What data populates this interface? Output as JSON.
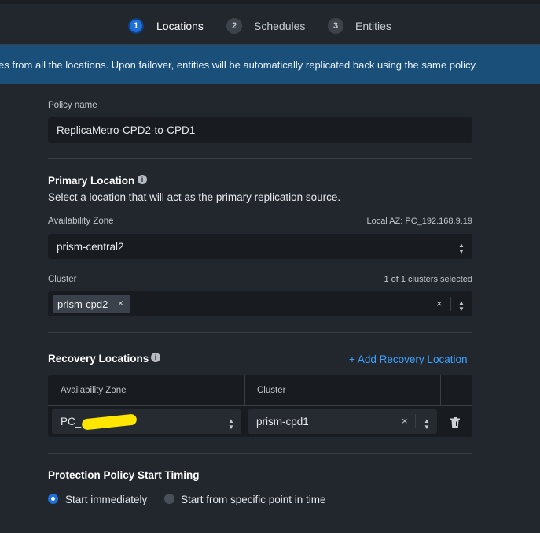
{
  "wizard": {
    "steps": [
      {
        "num": "1",
        "label": "Locations"
      },
      {
        "num": "2",
        "label": "Schedules"
      },
      {
        "num": "3",
        "label": "Entities"
      }
    ],
    "active_step": 0
  },
  "banner": {
    "text": "es from all the locations. Upon failover, entities will be automatically replicated back using the same policy."
  },
  "policy": {
    "name_label": "Policy name",
    "name_value": "ReplicaMetro-CPD2-to-CPD1"
  },
  "primary": {
    "heading": "Primary Location",
    "description": "Select a location that will act as the primary replication source.",
    "az_label": "Availability Zone",
    "local_az": "Local AZ: PC_192.168.9.19",
    "az_value": "prism-central2",
    "cluster_label": "Cluster",
    "cluster_count": "1 of 1 clusters selected",
    "cluster_tag": "prism-cpd2"
  },
  "recovery": {
    "heading": "Recovery Locations",
    "add_link": "+ Add Recovery Location",
    "col_az": "Availability Zone",
    "col_cluster": "Cluster",
    "row": {
      "az_value": "PC_",
      "cluster_value": "prism-cpd1"
    }
  },
  "timing": {
    "heading": "Protection Policy Start Timing",
    "options": [
      {
        "label": "Start immediately",
        "selected": true
      },
      {
        "label": "Start from specific point in time",
        "selected": false
      }
    ]
  },
  "colors": {
    "accent": "#1e6fd9",
    "link": "#3ea1ff",
    "banner_bg": "#1a4f7a",
    "page_bg": "#22272e"
  },
  "icons": [
    "info-icon",
    "chevron-updown-icon",
    "close-icon",
    "trash-icon",
    "radio-icon"
  ]
}
